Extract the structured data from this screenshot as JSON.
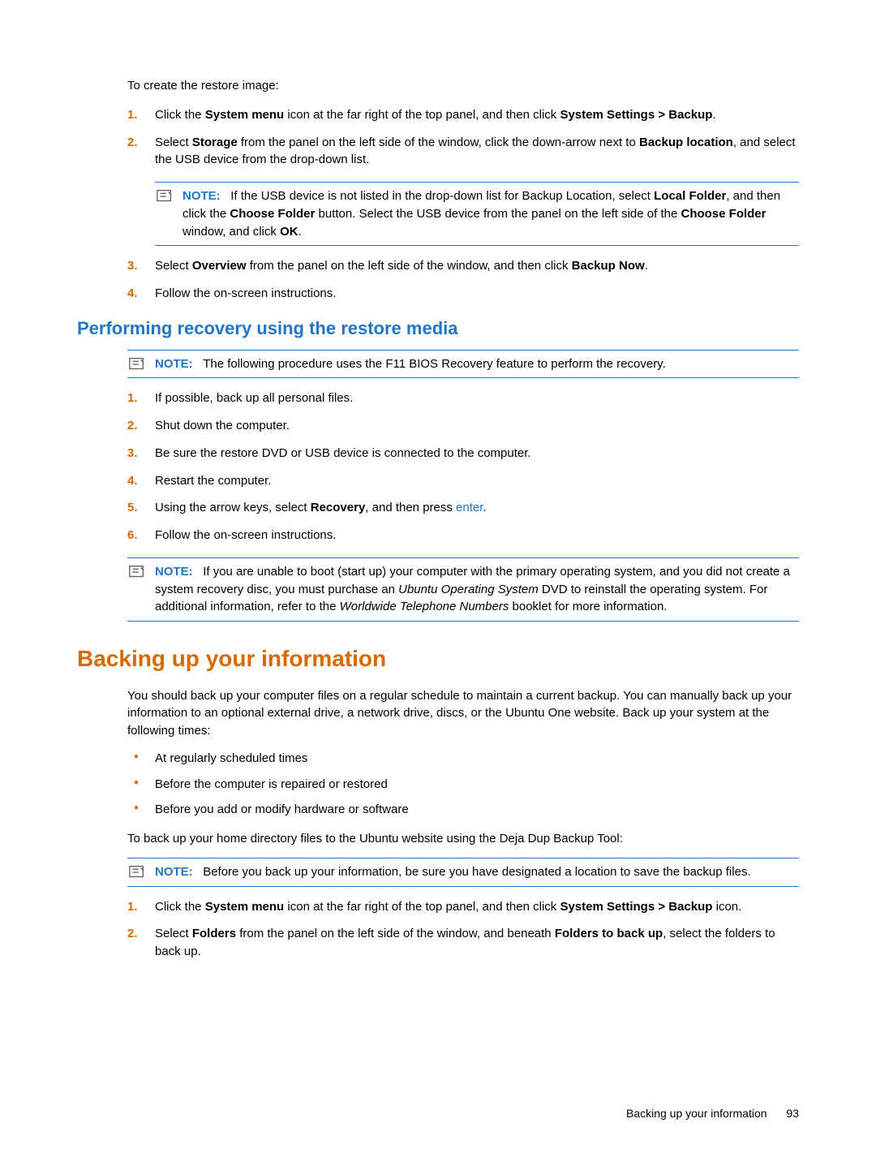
{
  "section1": {
    "intro": "To create the restore image:",
    "steps": {
      "s1": {
        "num": "1.",
        "pre": "Click the ",
        "b1": "System menu",
        "mid": " icon at the far right of the top panel, and then click ",
        "b2": "System Settings > Backup",
        "post": "."
      },
      "s2": {
        "num": "2.",
        "pre": "Select ",
        "b1": "Storage",
        "mid1": " from the panel on the left side of the window, click the down-arrow next to ",
        "b2": "Backup location",
        "post": ", and select the USB device from the drop-down list."
      },
      "note": {
        "label": "NOTE:",
        "pre": "If the USB device is not listed in the drop-down list for Backup Location, select ",
        "b1": "Local Folder",
        "mid1": ", and then click the ",
        "b2": "Choose Folder",
        "mid2": " button. Select the USB device from the panel on the left side of the ",
        "b3": "Choose Folder",
        "mid3": " window, and click ",
        "b4": "OK",
        "post": "."
      },
      "s3": {
        "num": "3.",
        "pre": "Select ",
        "b1": "Overview",
        "mid": " from the panel on the left side of the window, and then click ",
        "b2": "Backup Now",
        "post": "."
      },
      "s4": {
        "num": "4.",
        "text": "Follow the on-screen instructions."
      }
    }
  },
  "section2": {
    "heading": "Performing recovery using the restore media",
    "note1": {
      "label": "NOTE:",
      "text": "The following procedure uses the F11 BIOS Recovery feature to perform the recovery."
    },
    "steps": {
      "s1": {
        "num": "1.",
        "text": "If possible, back up all personal files."
      },
      "s2": {
        "num": "2.",
        "text": "Shut down the computer."
      },
      "s3": {
        "num": "3.",
        "text": "Be sure the restore DVD or USB device is connected to the computer."
      },
      "s4": {
        "num": "4.",
        "text": "Restart the computer."
      },
      "s5": {
        "num": "5.",
        "pre": "Using the arrow keys, select ",
        "b1": "Recovery",
        "mid": ", and then press ",
        "link": "enter",
        "post": "."
      },
      "s6": {
        "num": "6.",
        "text": "Follow the on-screen instructions."
      }
    },
    "note2": {
      "label": "NOTE:",
      "pre": "If you are unable to boot (start up) your computer with the primary operating system, and you did not create a system recovery disc, you must purchase an ",
      "i1": "Ubuntu Operating System",
      "mid": " DVD to reinstall the operating system. For additional information, refer to the ",
      "i2": "Worldwide Telephone Numbers",
      "post": " booklet for more information."
    }
  },
  "section3": {
    "heading": "Backing up your information",
    "para1": "You should back up your computer files on a regular schedule to maintain a current backup. You can manually back up your information to an optional external drive, a network drive, discs, or the Ubuntu One website. Back up your system at the following times:",
    "bullets": {
      "b1": "At regularly scheduled times",
      "b2": "Before the computer is repaired or restored",
      "b3": "Before you add or modify hardware or software"
    },
    "para2": "To back up your home directory files to the Ubuntu website using the Deja Dup Backup Tool:",
    "note": {
      "label": "NOTE:",
      "text": "Before you back up your information, be sure you have designated a location to save the backup files."
    },
    "steps": {
      "s1": {
        "num": "1.",
        "pre": "Click the ",
        "b1": "System menu",
        "mid": " icon at the far right of the top panel, and then click ",
        "b2": "System Settings > Backup",
        "post": " icon."
      },
      "s2": {
        "num": "2.",
        "pre": "Select ",
        "b1": "Folders",
        "mid": " from the panel on the left side of the window, and beneath ",
        "b2": "Folders to back up",
        "post": ", select the folders to back up."
      }
    }
  },
  "footer": {
    "text": "Backing up your information",
    "page": "93"
  }
}
